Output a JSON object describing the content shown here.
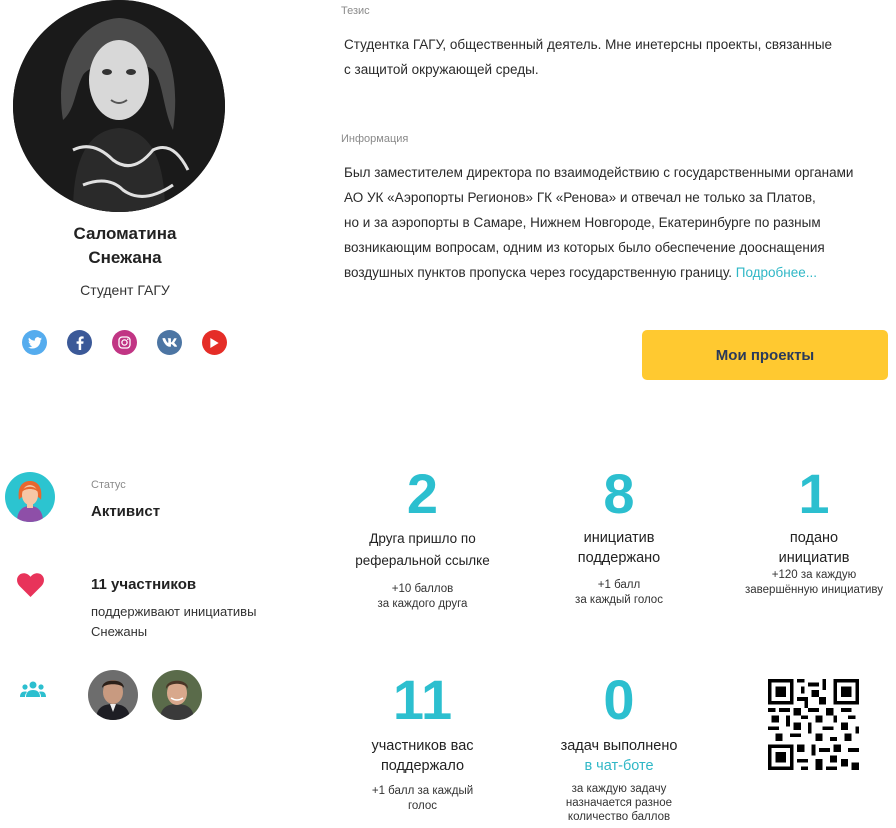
{
  "profile": {
    "name_line1": "Саломатина",
    "name_line2": "Снежана",
    "role": "Студент ГАГУ"
  },
  "socials": [
    {
      "icon": "twitter-icon",
      "color": "#55acee",
      "glyph": "t"
    },
    {
      "icon": "facebook-icon",
      "color": "#3b5998",
      "glyph": "f"
    },
    {
      "icon": "instagram-icon",
      "color": "#c13584",
      "glyph": "◎"
    },
    {
      "icon": "vk-icon",
      "color": "#4c75a3",
      "glyph": "vk"
    },
    {
      "icon": "youtube-icon",
      "color": "#e52d27",
      "glyph": "▶"
    }
  ],
  "thesis": {
    "label": "Тезис",
    "line1": "Студентка ГАГУ, общественный деятель. Мне инетерсны проекты, связанные",
    "line2": "с защитой окружающей среды."
  },
  "info": {
    "label": "Информация",
    "line1": "Был заместителем директора по взаимодействию с государственными органами",
    "line2": "АО УК «Аэропорты Регионов» ГК «Ренова» и отвечал не только за Платов,",
    "line3": "но и за аэропорты в Самаре, Нижнем Новгороде, Екатеринбурге по разным",
    "line4": "возникающим вопросам, одним из которых было обеспечение дооснащения",
    "line5": "воздушных пунктов пропуска через государственную границу.",
    "more": "Подробнее..."
  },
  "my_projects_label": "Мои проекты",
  "status": {
    "label": "Статус",
    "value": "Активист"
  },
  "supporters": {
    "count": "11 участников",
    "text": "поддерживают инициативы Снежаны"
  },
  "stats": {
    "friends": {
      "number": "2",
      "title1": "Друга пришло по",
      "title2": "реферальной ссылке",
      "note1": "+10 баллов",
      "note2": "за каждого друга"
    },
    "initiatives_supported": {
      "number": "8",
      "title1": "инициатив",
      "title2": "поддержано",
      "note1": "+1 балл",
      "note2": "за каждый голос"
    },
    "initiatives_submitted": {
      "number": "1",
      "title1": "подано",
      "title2": "инициатив",
      "note1": "+120 за каждую",
      "note2": "завершённую инициативу"
    },
    "supporters": {
      "number": "11",
      "title1": "участников вас",
      "title2": "поддержало",
      "note1": "+1 балл за каждый",
      "note2": "голос"
    },
    "tasks": {
      "number": "0",
      "title1": "задач выполнено",
      "title2": "в чат-боте",
      "note1": "за каждую задачу",
      "note2": "назначается разное",
      "note3": "количество баллов"
    }
  },
  "colors": {
    "accent": "#2cbfcf",
    "button": "#ffc930",
    "heart": "#e8335a",
    "link": "#2fb7c6"
  }
}
